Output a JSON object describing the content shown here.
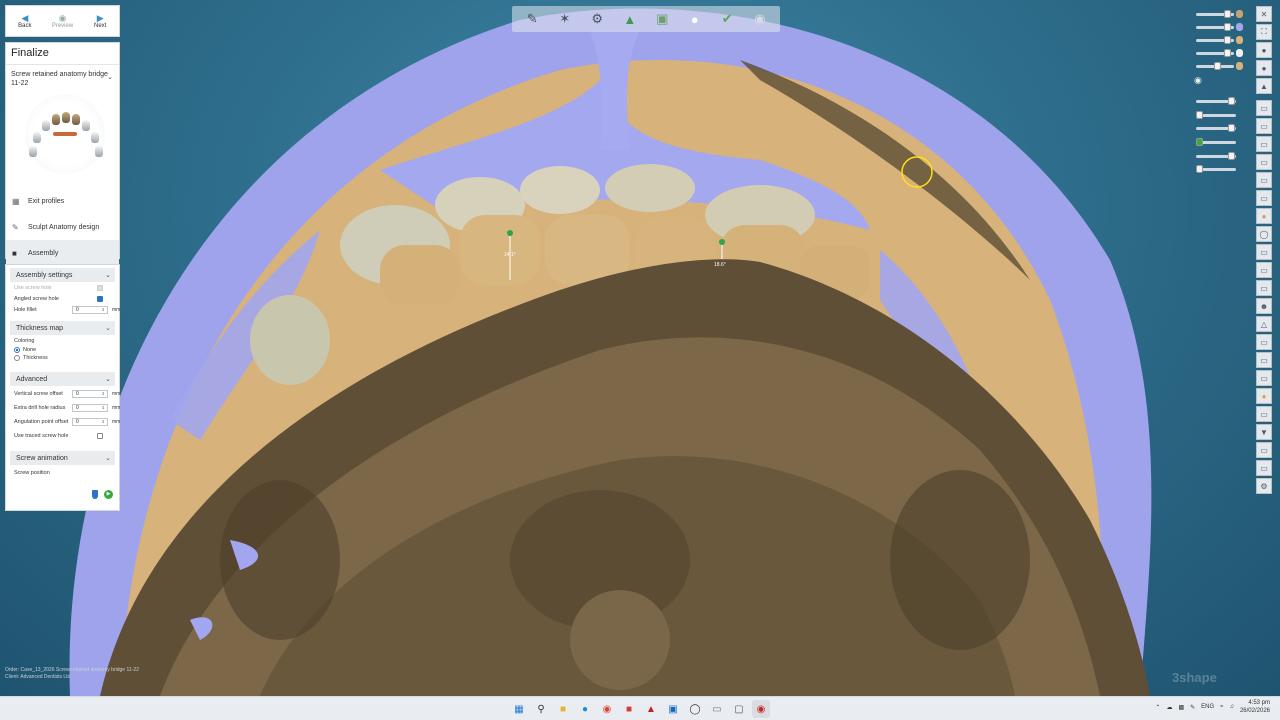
{
  "nav": {
    "back_label": "Back",
    "preview_label": "Preview",
    "next_label": "Next"
  },
  "wizard": {
    "title": "Finalize",
    "case_name": "Screw retained anatomy bridge 11-22",
    "steps": [
      {
        "label": "Exit profiles",
        "icon": "profile-icon"
      },
      {
        "label": "Sculpt Anatomy design",
        "icon": "sculpt-icon"
      },
      {
        "label": "Assembly",
        "icon": "assembly-icon"
      }
    ]
  },
  "settings": {
    "assembly": {
      "title": "Assembly settings",
      "use_screw_hole": "Use screw hole",
      "angled_screw_hole": "Angled screw hole",
      "angled_checked": true,
      "hole_fillet_label": "Hole fillet",
      "hole_fillet_value": "0",
      "unit": "mm"
    },
    "thickness": {
      "title": "Thickness map",
      "coloring_label": "Coloring",
      "option_none": "None",
      "option_thickness": "Thickness",
      "selected": "None"
    },
    "advanced": {
      "title": "Advanced",
      "vertical_offset_label": "Vertical screw offset",
      "vertical_offset_value": "0",
      "drill_radius_label": "Extra drill hole radius",
      "drill_radius_value": "0",
      "angulation_label": "Angulation point offset",
      "angulation_value": "0",
      "traced_label": "Use traced screw hole",
      "traced_checked": false,
      "unit": "mm"
    },
    "animation": {
      "title": "Screw animation",
      "position_label": "Screw position"
    }
  },
  "viewport": {
    "screw_labels": [
      "14.1°",
      "18.6°"
    ]
  },
  "status": {
    "line1": "Order:  Case_13_2026  Screw retained anatomy bridge 11-22",
    "line2": "Client:  Advanced  Dentists Ltd"
  },
  "brand": "3shape",
  "taskbar": {
    "lang": "ENG",
    "time": "4:53 pm",
    "date": "26/02/2026"
  },
  "colors": {
    "model_tan": "#d8b47e",
    "model_dark": "#5a4a32",
    "gingiva_blue": "#a2a6ee",
    "tooth": "#dcbd8a",
    "accent_blue": "#2e72c8"
  }
}
